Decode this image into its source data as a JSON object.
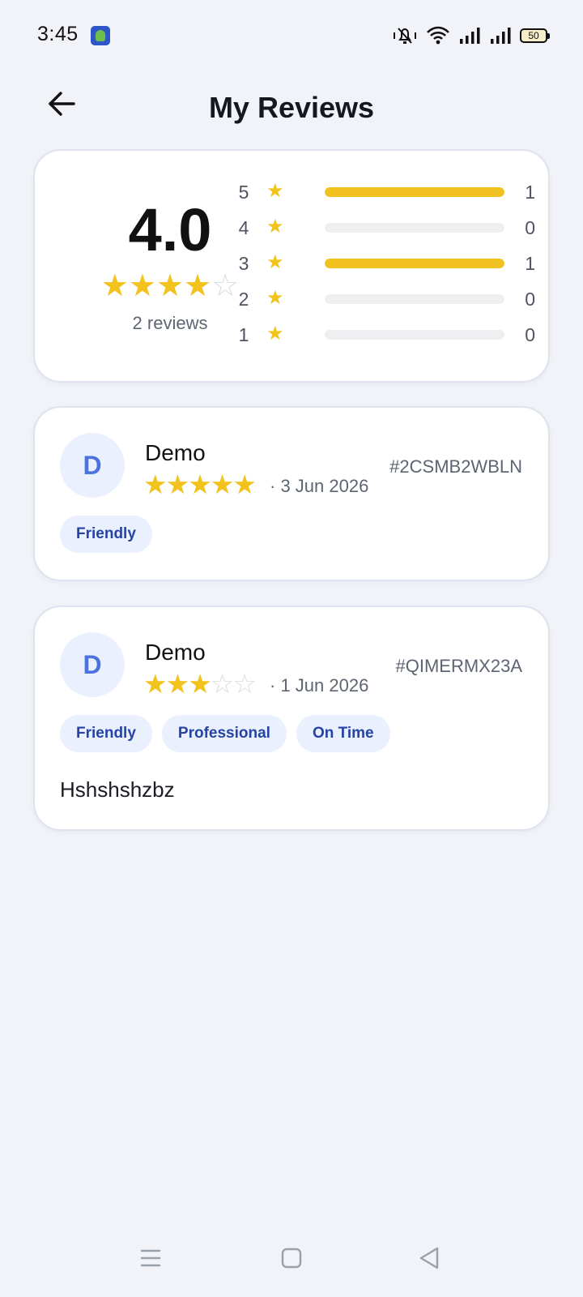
{
  "status_bar": {
    "time": "3:45",
    "battery": "50",
    "icons": [
      "app-notification-icon",
      "vibrate-mute-icon",
      "wifi-icon",
      "signal-icon",
      "signal-icon",
      "battery-icon"
    ]
  },
  "header": {
    "title": "My Reviews",
    "back_icon": "arrow-left-icon"
  },
  "summary": {
    "rating": "4.0",
    "stars_filled": 4,
    "stars_total": 5,
    "review_count": "2 reviews",
    "distribution": [
      {
        "label": "5",
        "count": "1",
        "fraction": 1.0
      },
      {
        "label": "4",
        "count": "0",
        "fraction": 0.0
      },
      {
        "label": "3",
        "count": "1",
        "fraction": 1.0
      },
      {
        "label": "2",
        "count": "0",
        "fraction": 0.0
      },
      {
        "label": "1",
        "count": "0",
        "fraction": 0.0
      }
    ]
  },
  "reviews": [
    {
      "avatar_letter": "D",
      "name": "Demo",
      "stars": 5,
      "date": "3 Jun 2026",
      "id": "#2CSMB2WBLN",
      "tags": [
        "Friendly"
      ],
      "text": ""
    },
    {
      "avatar_letter": "D",
      "name": "Demo",
      "stars": 3,
      "date": "1 Jun 2026",
      "id": "#QIMERMX23A",
      "tags": [
        "Friendly",
        "Professional",
        "On Time"
      ],
      "text": "Hshshshzbz"
    }
  ],
  "colors": {
    "accent_star": "#f2c21d",
    "tag_bg": "#eaf0fd",
    "tag_text": "#2643a6",
    "background": "#f1f3f8"
  },
  "nav": {
    "items": [
      "menu-icon",
      "home-square-icon",
      "back-triangle-icon"
    ]
  }
}
